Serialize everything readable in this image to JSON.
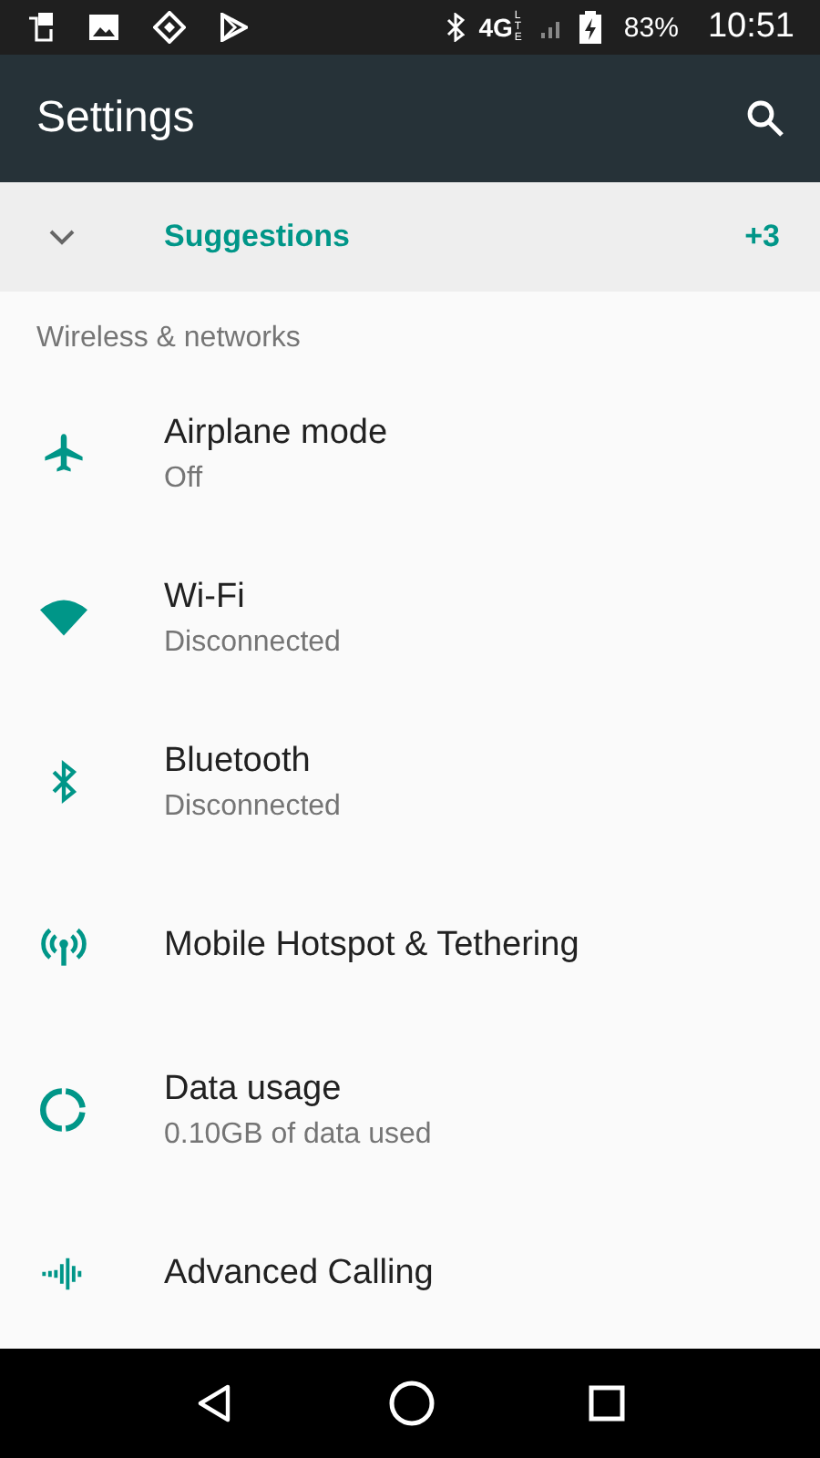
{
  "status_bar": {
    "network": "4G",
    "network_sub": "LTE",
    "battery": "83%",
    "time": "10:51"
  },
  "app_bar": {
    "title": "Settings"
  },
  "suggestions": {
    "label": "Suggestions",
    "count": "+3",
    "expanded": false
  },
  "section": {
    "title": "Wireless & networks"
  },
  "items": [
    {
      "title": "Airplane mode",
      "summary": "Off"
    },
    {
      "title": "Wi-Fi",
      "summary": "Disconnected"
    },
    {
      "title": "Bluetooth",
      "summary": "Disconnected"
    },
    {
      "title": "Mobile Hotspot & Tethering"
    },
    {
      "title": "Data usage",
      "summary": "0.10GB of data used"
    },
    {
      "title": "Advanced Calling"
    }
  ]
}
